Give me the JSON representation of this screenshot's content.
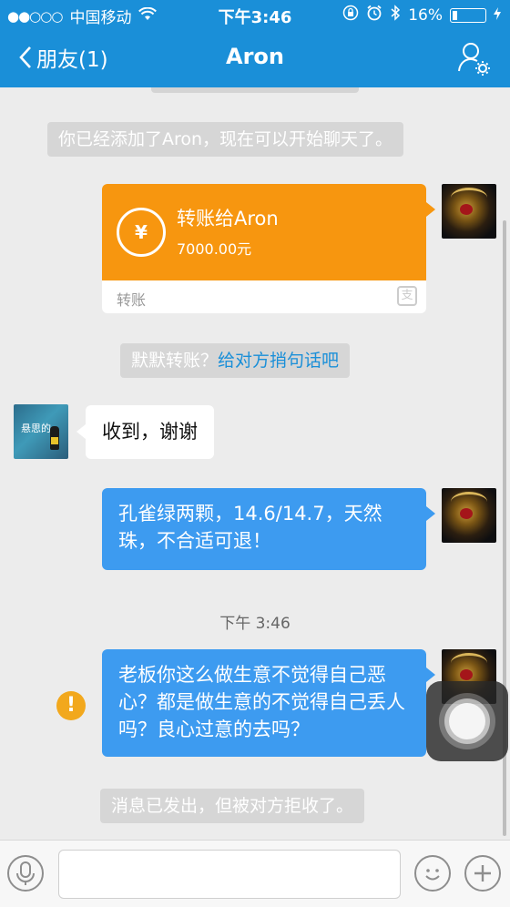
{
  "status_bar": {
    "signal": "●●○○○",
    "carrier": "中国移动",
    "time": "下午3:46",
    "battery_percent": "16%",
    "battery_level": 0.16
  },
  "nav": {
    "back_label": "朋友(1)",
    "title": "Aron"
  },
  "messages": {
    "system_added": "你已经添加了Aron，现在可以开始聊天了。",
    "transfer": {
      "title": "转账给Aron",
      "amount": "7000.00元",
      "label": "转账",
      "coin_symbol": "¥",
      "brand_glyph": "支"
    },
    "transfer_note_prefix": "默默转账？",
    "transfer_note_link": "给对方捎句话吧",
    "received_reply": "收到，谢谢",
    "sent_item": "孔雀绿两颗，14.6/14.7，天然珠，不合适可退！",
    "timestamp": "下午 3:46",
    "sent_complaint": "老板你这么做生意不觉得自己恶心？都是做生意的不觉得自己丢人吗？良心过意的去吗？",
    "warning_glyph": "!",
    "system_rejected": "消息已发出，但被对方拒收了。",
    "my_avatar_text": "悬思的"
  },
  "input_bar": {
    "text_value": "",
    "placeholder": ""
  },
  "colors": {
    "nav_blue": "#1a8fd8",
    "bubble_blue": "#3d9bf0",
    "transfer_orange": "#f7960f",
    "warning_orange": "#f2a81d"
  }
}
